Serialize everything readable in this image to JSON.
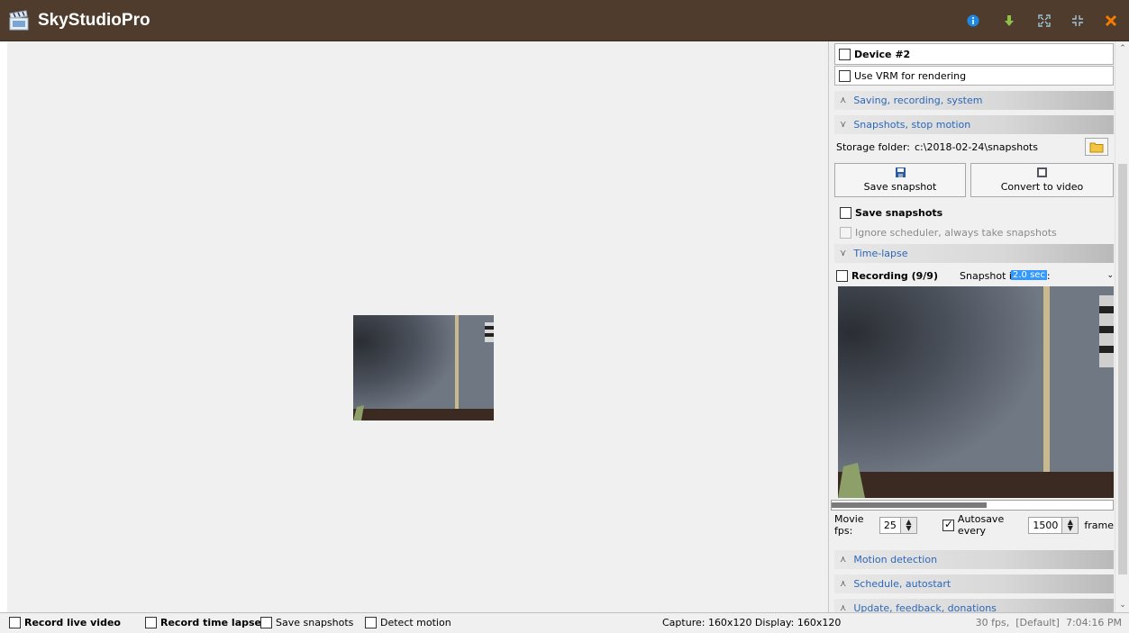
{
  "app": {
    "title": "SkyStudioPro"
  },
  "titlebar": {
    "icons": [
      "info-icon",
      "download-icon",
      "fullscreen-icon",
      "compact-icon",
      "close-icon"
    ],
    "colors": {
      "background": "#503c2d",
      "info": "#1e88e5",
      "download": "#7cb342",
      "close": "#f57c00",
      "toolbar": "#a0c4d8"
    }
  },
  "panel": {
    "device2_label": "Device #2",
    "use_vrm_label": "Use VRM for rendering",
    "sections": {
      "saving": "Saving, recording, system",
      "snapshots": "Snapshots, stop motion",
      "timelapse": "Time-lapse",
      "motion": "Motion detection",
      "schedule": "Schedule, autostart",
      "update": "Update, feedback, donations"
    },
    "snapshots": {
      "storage_label": "Storage folder:",
      "storage_path": "c:\\2018-02-24\\snapshots",
      "save_snapshot_button": "Save snapshot",
      "convert_button": "Convert to video",
      "save_snapshots_checkbox": "Save snapshots",
      "ignore_scheduler_checkbox": "Ignore scheduler, always take snapshots"
    },
    "timelapse": {
      "recording_label": "Recording (9/9)",
      "interval_label": "Snapshot interval:",
      "interval_value": "2.0 sec",
      "movie_fps_label": "Movie fps:",
      "movie_fps_value": "25",
      "autosave_label": "Autosave every",
      "autosave_value": "1500",
      "frames_label": "frame",
      "progress": 0.55
    }
  },
  "statusbar": {
    "record_live": "Record live video",
    "record_timelapse": "Record time lapse",
    "save_snapshots": "Save snapshots",
    "detect_motion": "Detect motion",
    "capture_info": "Capture: 160x120 Display: 160x120",
    "fps_info": "30 fps,  [Default]  7:04:16 PM"
  }
}
